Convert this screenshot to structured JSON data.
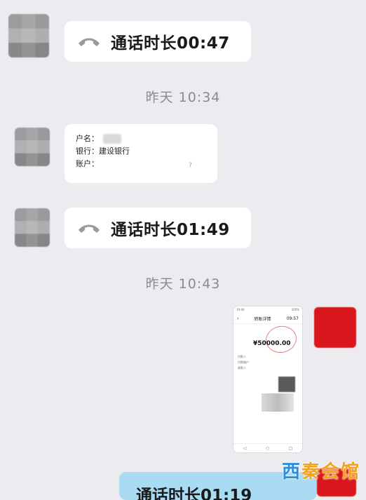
{
  "messages": {
    "call1": {
      "text": "通话时长00:47",
      "icon": "phone-hangup-icon"
    },
    "time1": "昨天 10:34",
    "bank": {
      "name_label": "户名：",
      "bank_label": "银行：建设银行",
      "account_label": "账户：",
      "mark": "?"
    },
    "call2": {
      "text": "通话时长01:49",
      "icon": "phone-hangup-icon"
    },
    "time2": "昨天 10:43",
    "screenshot": {
      "status_left": "19:40",
      "status_right": "100%",
      "title": "转账详情",
      "nav_right": "09:57",
      "amount": "¥50000.00",
      "lines": [
        "付款人",
        "付款账户",
        "收款人"
      ]
    },
    "partial_call": "通话时长01:19"
  },
  "watermark": {
    "part1": "西",
    "part2": "秦会馆"
  },
  "colors": {
    "accent_red": "#d8161b",
    "sent_bubble": "#a9dbf3"
  }
}
